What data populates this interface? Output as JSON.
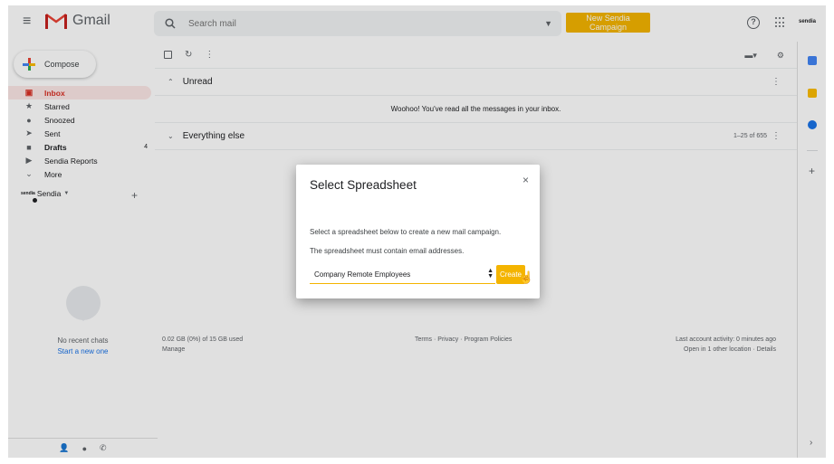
{
  "header": {
    "app_name": "Gmail",
    "search_placeholder": "Search mail",
    "campaign_button": "New Sendia Campaign",
    "help_glyph": "?",
    "account_brand": "sendia"
  },
  "compose": {
    "label": "Compose"
  },
  "sidebar": {
    "items": [
      {
        "label": "Inbox",
        "icon": "inbox-icon",
        "active": true,
        "count": ""
      },
      {
        "label": "Starred",
        "icon": "star-icon",
        "count": ""
      },
      {
        "label": "Snoozed",
        "icon": "clock-icon",
        "count": ""
      },
      {
        "label": "Sent",
        "icon": "send-icon",
        "count": ""
      },
      {
        "label": "Drafts",
        "icon": "file-icon",
        "count": "4"
      },
      {
        "label": "Sendia Reports",
        "icon": "label-icon",
        "count": ""
      },
      {
        "label": "More",
        "icon": "chevron-down-icon",
        "count": ""
      }
    ],
    "account_mini": "sendia",
    "account_label": "Sendia",
    "add_glyph": "+"
  },
  "chat": {
    "empty_text": "No recent chats",
    "start_link": "Start a new one"
  },
  "main": {
    "unread_section": "Unread",
    "unread_empty": "Woohoo! You've read all the messages in your inbox.",
    "everything_section": "Everything else",
    "range": "1–25 of 655"
  },
  "footer": {
    "storage": "0.02 GB (0%) of 15 GB used",
    "manage": "Manage",
    "links": "Terms · Privacy · Program Policies",
    "activity": "Last account activity: 0 minutes ago",
    "details": "Open in 1 other location · Details"
  },
  "modal": {
    "title": "Select Spreadsheet",
    "close_glyph": "×",
    "text1": "Select a spreadsheet below to create a new mail campaign.",
    "text2": "The spreadsheet must contain email addresses.",
    "selected": "Company Remote Employees",
    "create": "Create"
  },
  "colors": {
    "accent": "#f4b400",
    "active_nav": "#d93025",
    "link": "#1a73e8"
  }
}
